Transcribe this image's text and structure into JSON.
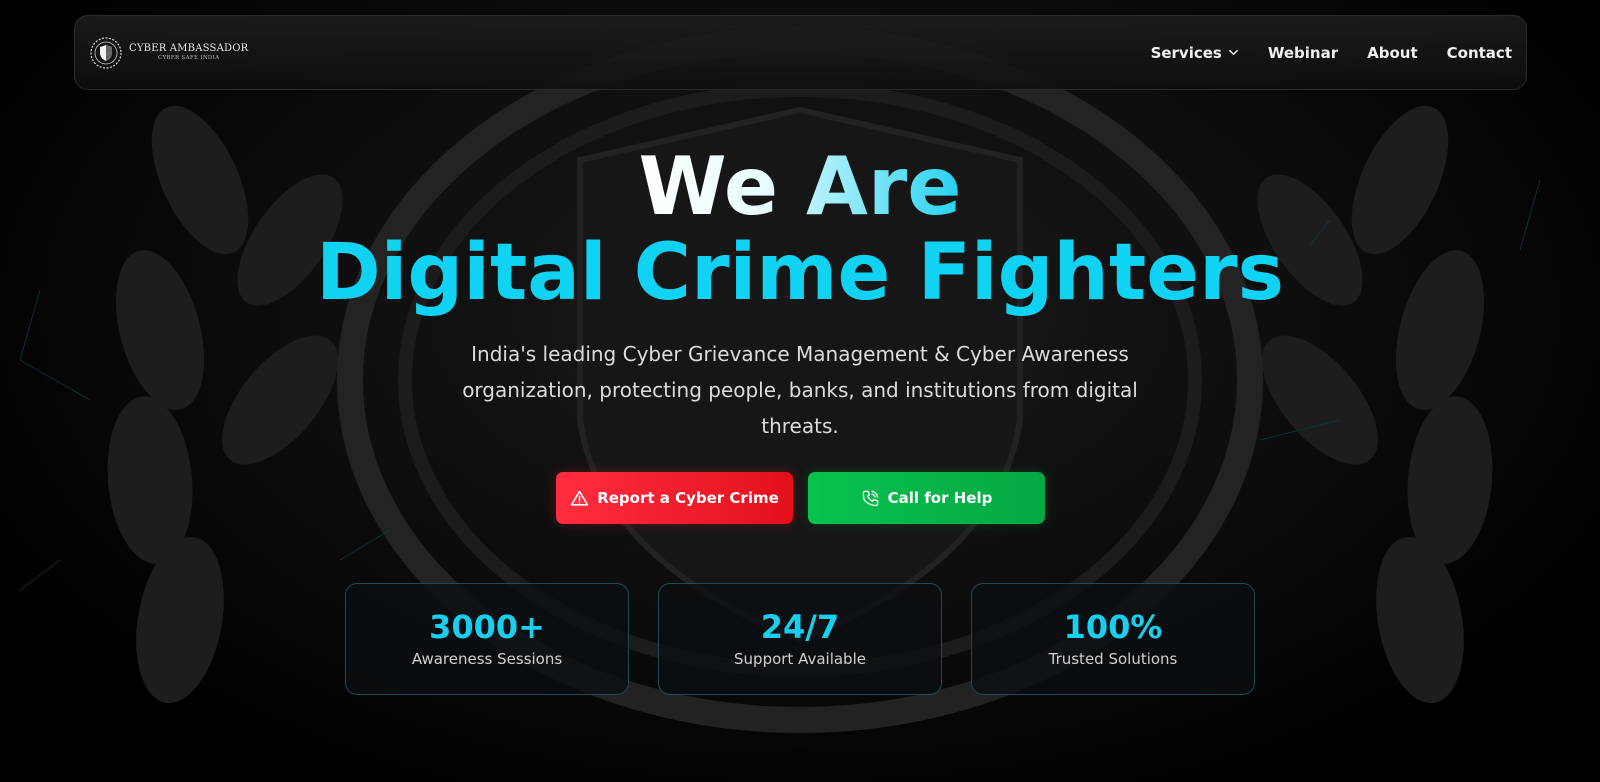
{
  "brand": {
    "title": "CYBER AMBASSADOR",
    "subtitle": "CYBER SAFE INDIA"
  },
  "nav": {
    "items": [
      {
        "label": "Services",
        "has_dropdown": true
      },
      {
        "label": "Webinar"
      },
      {
        "label": "About"
      },
      {
        "label": "Contact"
      }
    ]
  },
  "hero": {
    "title_line1": "We Are",
    "title_line2": "Digital Crime Fighters",
    "subtitle": "India's leading Cyber Grievance Management & Cyber Awareness organization, protecting people, banks, and institutions from digital threats."
  },
  "buttons": {
    "report": {
      "label": "Report a Cyber Crime",
      "icon": "warning-triangle-icon",
      "color": "#e3101c"
    },
    "call": {
      "label": "Call for Help",
      "icon": "phone-icon",
      "color": "#06a844"
    }
  },
  "stats": [
    {
      "value": "3000+",
      "label": "Awareness Sessions"
    },
    {
      "value": "24/7",
      "label": "Support Available"
    },
    {
      "value": "100%",
      "label": "Trusted Solutions"
    }
  ],
  "colors": {
    "accent": "#10d3f3",
    "background": "#000000"
  }
}
